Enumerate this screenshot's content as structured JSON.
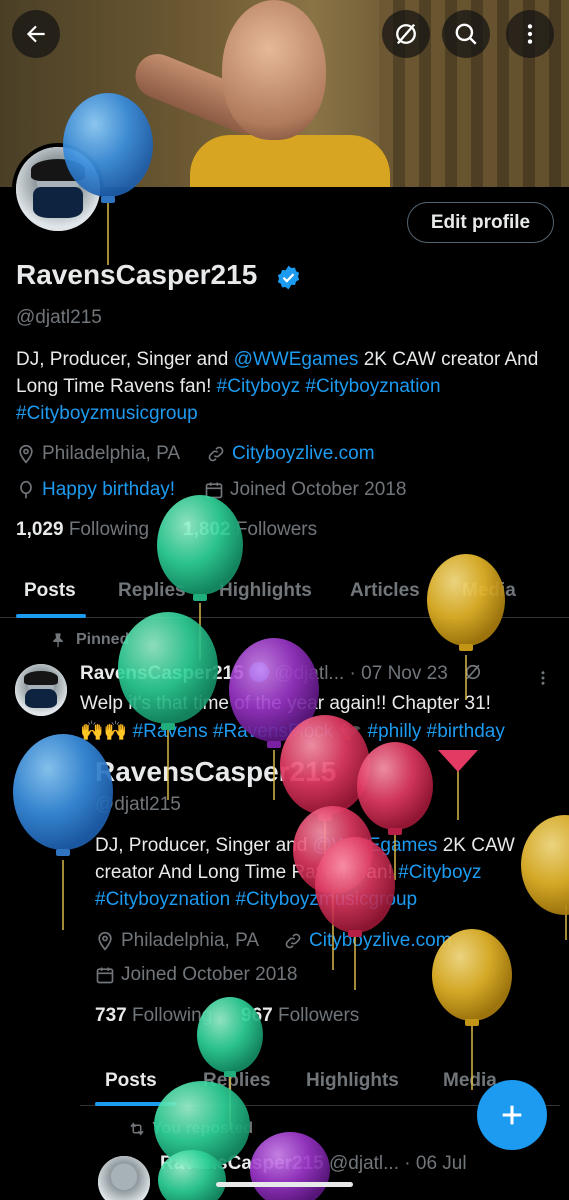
{
  "header": {
    "back_icon": "arrow-left-icon",
    "stop_icon": "circle-slash-icon",
    "search_icon": "search-icon",
    "more_icon": "more-vertical-icon"
  },
  "profile": {
    "edit_label": "Edit profile",
    "name": "RavensCasper215",
    "handle": "@djatl215",
    "bio_parts": [
      "DJ, Producer, Singer and ",
      "@WWEgames",
      " 2K CAW creator And Long Time Ravens fan! ",
      "#Cityboyz",
      " ",
      "#Cityboyznation",
      " ",
      "#Cityboyzmusicgroup"
    ],
    "location": "Philadelphia, PA",
    "website": "Cityboyzlive.com",
    "birthday": "Happy birthday!",
    "joined": "Joined October 2018",
    "following_count": "1,029",
    "following_label": "Following",
    "followers_count": "1,802",
    "followers_label": "Followers"
  },
  "tabs": [
    "Posts",
    "Replies",
    "Highlights",
    "Articles",
    "Media"
  ],
  "pinned_tweet": {
    "pinned_label": "Pinned",
    "name": "RavensCasper215",
    "handle": "@djatl...",
    "date": "· 07 Nov 23",
    "text_line1": "Welp it's that time of the year again!! Chapter 31!",
    "text_line2_emoji": "🙌🙌",
    "hashtags": [
      "#Ravens",
      "#RavensFlock",
      "#philly",
      "#birthday"
    ]
  },
  "embedded_profile": {
    "name": "RavensCasper215",
    "handle": "@djatl215",
    "bio_parts": [
      "DJ, Producer, Singer and ",
      "@WWEgames",
      " 2K CAW creator And Long Time Ravens fan! ",
      "#Cityboyz",
      " ",
      "#Cityboyznation",
      " ",
      "#Cityboyzmusicgroup"
    ],
    "location": "Philadelphia, PA",
    "website": "Cityboyzlive.com",
    "joined": "Joined October 2018",
    "following_count": "737",
    "following_label": "Following",
    "followers_count": "967",
    "followers_label": "Followers",
    "tabs": [
      "Posts",
      "Replies",
      "Highlights",
      "Media"
    ]
  },
  "repost": {
    "label": "You reposted",
    "name": "RavensCasper215",
    "handle": "@djatl...",
    "date": "· 06 Jul"
  },
  "fab_icon": "plus-icon",
  "colors": {
    "accent": "#1d9bf0",
    "background": "#000000",
    "muted": "#71767b",
    "balloon_blue": "#3a8fe0",
    "balloon_green": "#2fd39a",
    "balloon_purple": "#9b36c9",
    "balloon_red": "#e23a63",
    "balloon_yellow": "#e6b72a"
  }
}
